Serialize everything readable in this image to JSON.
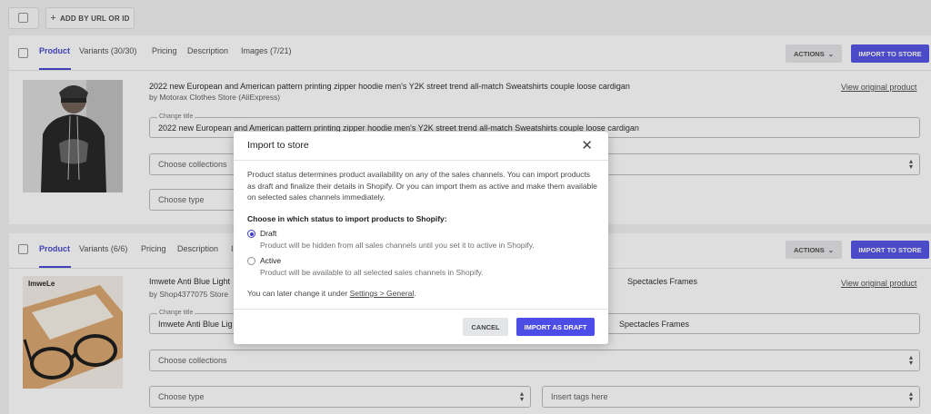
{
  "topbar": {
    "add_label": "ADD BY URL OR ID"
  },
  "products": [
    {
      "tabs": [
        "Product",
        "Variants (30/30)",
        "Pricing",
        "Description",
        "Images (7/21)"
      ],
      "actions_label": "ACTIONS",
      "import_label": "IMPORT TO STORE",
      "title": "2022 new European and American pattern printing zipper hoodie men's Y2K street trend all-match Sweatshirts couple loose cardigan",
      "by": "by Motorax Clothes Store (AliExpress)",
      "view_link": "View original product",
      "change_title_legend": "Change title",
      "change_title_value": "2022 new European and American pattern printing zipper hoodie men's Y2K street trend all-match Sweatshirts couple loose cardigan",
      "collections_placeholder": "Choose collections",
      "type_placeholder": "Choose type"
    },
    {
      "tabs": [
        "Product",
        "Variants (6/6)",
        "Pricing",
        "Description",
        "I"
      ],
      "actions_label": "ACTIONS",
      "import_label": "IMPORT TO STORE",
      "title_left": "Imwete Anti Blue Light",
      "title_right": "Spectacles Frames",
      "by": "by Shop4377075 Store",
      "view_link": "View original product",
      "change_title_legend": "Change title",
      "change_title_left": "Imwete Anti Blue Lig",
      "change_title_right": "Spectacles Frames",
      "collections_placeholder": "Choose collections",
      "type_placeholder": "Choose type",
      "tags_placeholder": "Insert tags here",
      "thumb_brand": "ImweLe"
    }
  ],
  "modal": {
    "title": "Import to store",
    "body": "Product status determines product availability on any of the sales channels. You can import products as draft and finalize their details in Shopify. Or you can import them as active and make them available on selected sales channels immediately.",
    "question": "Choose in which status to import products to Shopify:",
    "options": [
      {
        "label": "Draft",
        "desc": "Product will be hidden from all sales channels until you set it to active in Shopify.",
        "selected": true
      },
      {
        "label": "Active",
        "desc": "Product will be available to all selected sales channels in Shopify.",
        "selected": false
      }
    ],
    "later_prefix": "You can later change it under ",
    "later_link": "Settings > General",
    "later_suffix": ".",
    "cancel_label": "CANCEL",
    "confirm_label": "IMPORT AS DRAFT"
  },
  "colors": {
    "accent": "#4c4ce6",
    "tab_active": "#3d3dcf"
  }
}
